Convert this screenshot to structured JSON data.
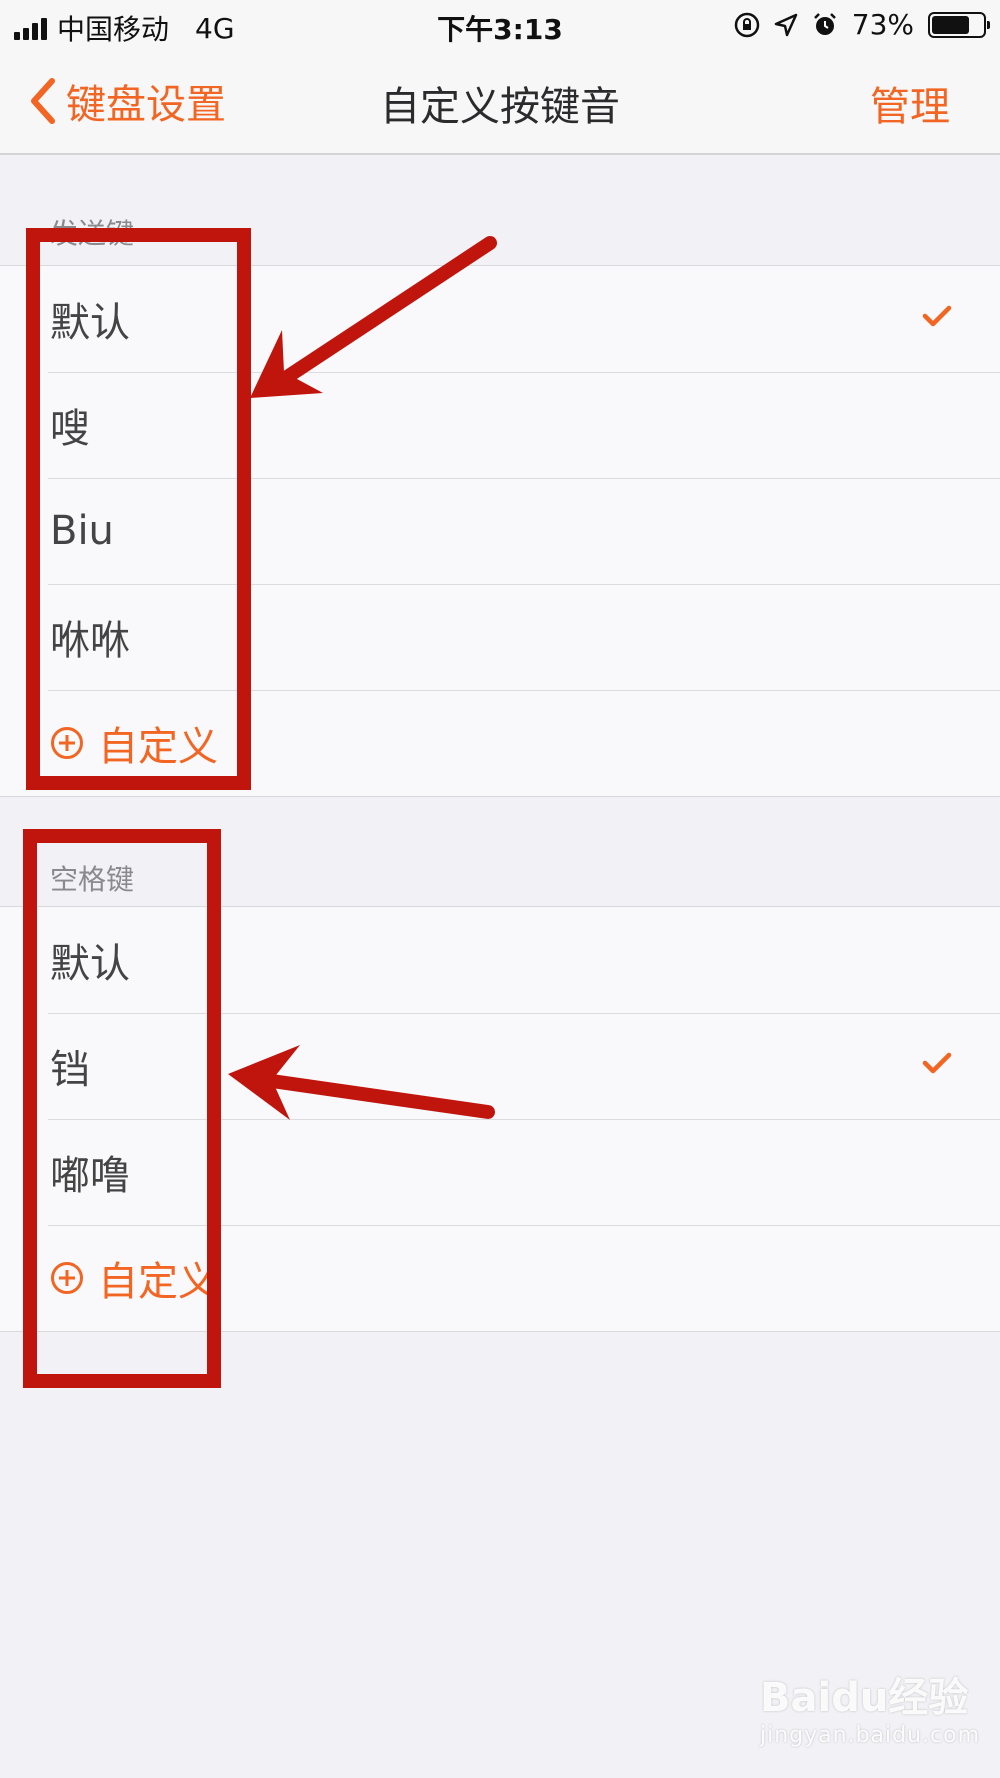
{
  "status_bar": {
    "carrier": "中国移动",
    "network": "4G",
    "time": "下午3:13",
    "battery": "73%",
    "battery_level": 0.73
  },
  "nav": {
    "back_label": "键盘设置",
    "title": "自定义按键音",
    "manage_label": "管理"
  },
  "send_key": {
    "header": "发送键",
    "items": [
      {
        "label": "默认",
        "selected": true
      },
      {
        "label": "嗖",
        "selected": false
      },
      {
        "label": "Biu",
        "selected": false
      },
      {
        "label": "咻咻",
        "selected": false
      }
    ],
    "add_label": "自定义"
  },
  "space_key": {
    "header": "空格键",
    "items": [
      {
        "label": "默认",
        "selected": false
      },
      {
        "label": "铛",
        "selected": true
      },
      {
        "label": "嘟噜",
        "selected": false
      }
    ],
    "add_label": "自定义"
  },
  "colors": {
    "accent": "#f26522",
    "annotation": "#c0150d"
  },
  "watermark": {
    "brand": "Baidu经验",
    "url": "jingyan.baidu.com"
  }
}
